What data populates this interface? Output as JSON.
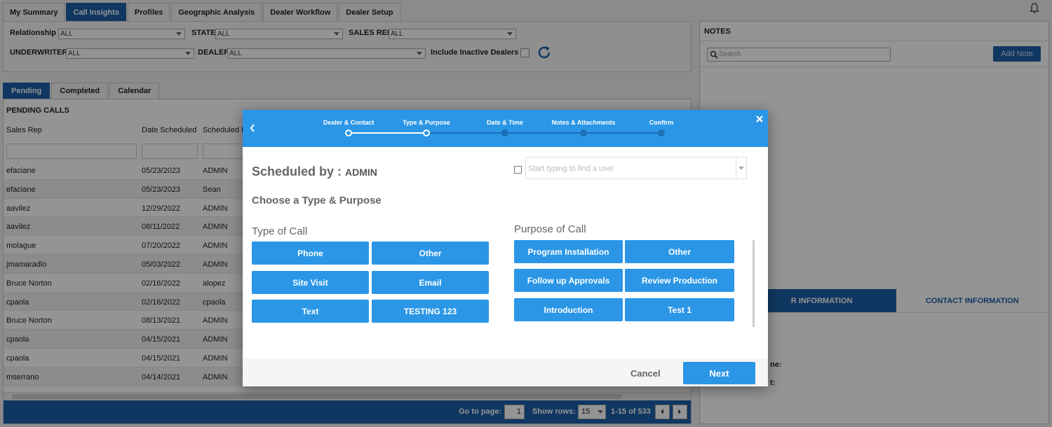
{
  "top_tabs": [
    "My Summary",
    "Call Insights",
    "Profiles",
    "Geographic Analysis",
    "Dealer Workflow",
    "Dealer Setup"
  ],
  "filters": {
    "relationship_label": "Relationship",
    "relationship_value": "ALL",
    "state_label": "STATE",
    "state_value": "ALL",
    "sales_rep_label": "SALES REP",
    "sales_rep_value": "ALL",
    "underwriter_label": "UNDERWRITER",
    "underwriter_value": "ALL",
    "dealer_label": "DEALER",
    "dealer_value": "ALL",
    "include_inactive_label": "Include Inactive Dealers"
  },
  "sub_tabs": [
    "Pending",
    "Completed",
    "Calendar"
  ],
  "grid": {
    "title": "PENDING CALLS",
    "columns": [
      "Sales Rep",
      "Date Scheduled",
      "Scheduled B"
    ],
    "rows": [
      [
        "efaciane",
        "05/23/2023",
        "ADMIN"
      ],
      [
        "efaciane",
        "05/23/2023",
        "Sean"
      ],
      [
        "aavilez",
        "12/29/2022",
        "ADMIN"
      ],
      [
        "aavilez",
        "08/11/2022",
        "ADMIN"
      ],
      [
        "molague",
        "07/20/2022",
        "ADMIN"
      ],
      [
        "jmamaradlo",
        "05/03/2022",
        "ADMIN"
      ],
      [
        "Bruce Norton",
        "02/16/2022",
        "alopez"
      ],
      [
        "cpaola",
        "02/16/2022",
        "cpaola"
      ],
      [
        "Bruce Norton",
        "08/13/2021",
        "ADMIN"
      ],
      [
        "cpaola",
        "04/15/2021",
        "ADMIN"
      ],
      [
        "cpaola",
        "04/15/2021",
        "ADMIN"
      ],
      [
        "mserrano",
        "04/14/2021",
        "ADMIN"
      ]
    ]
  },
  "pager": {
    "go_to_label": "Go to page:",
    "page": "1",
    "show_rows_label": "Show rows:",
    "rows": "15",
    "range": "1-15 of 533"
  },
  "notes": {
    "title": "NOTES",
    "search_placeholder": "Search",
    "add_label": "Add Note",
    "tab_dealer": "R INFORMATION",
    "tab_contact": "CONTACT INFORMATION",
    "lbl1": "ne:",
    "lbl2": "t:"
  },
  "modal": {
    "steps": [
      "Dealer & Contact",
      "Type & Purpose",
      "Date & Time",
      "Notes & Attachments",
      "Confirm"
    ],
    "scheduled_by_label": "Scheduled by : ",
    "scheduled_by_user": "ADMIN",
    "user_placeholder": "Start typing to find a user",
    "choose_title": "Choose a Type & Purpose",
    "type_title": "Type of Call",
    "purpose_title": "Purpose of Call",
    "type_buttons": [
      "Phone",
      "Other",
      "Site Visit",
      "Email",
      "Text",
      "TESTING 123"
    ],
    "purpose_buttons": [
      "Program Installation",
      "Other",
      "Follow up Approvals",
      "Review Production",
      "Introduction",
      "Test 1"
    ],
    "cancel_label": "Cancel",
    "next_label": "Next"
  },
  "colors": {
    "brand": "#1c5fa8",
    "accent": "#2b96e6"
  }
}
